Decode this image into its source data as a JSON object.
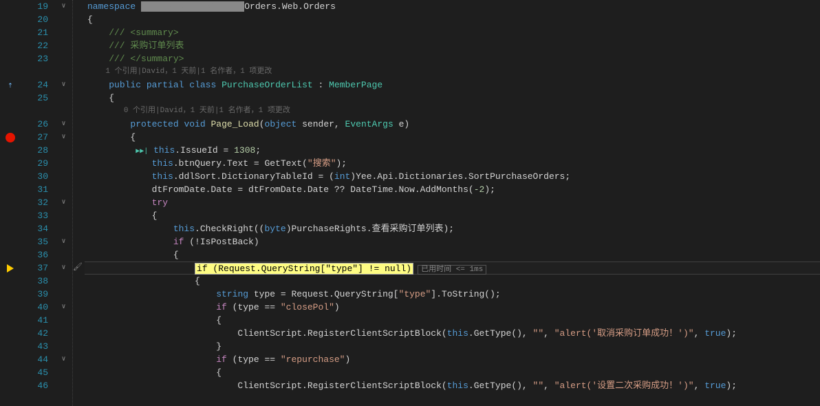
{
  "line_numbers": [
    "19",
    "20",
    "21",
    "22",
    "23",
    "",
    "24",
    "25",
    "",
    "26",
    "27",
    "28",
    "29",
    "30",
    "31",
    "32",
    "33",
    "34",
    "35",
    "36",
    "37",
    "38",
    "39",
    "40",
    "41",
    "42",
    "43",
    "44",
    "45",
    "46"
  ],
  "fold": {
    "l19": "∨",
    "l24": "∨",
    "l26": "∨",
    "l27": "∨",
    "l32": "∨",
    "l35": "∨",
    "l37": "∨",
    "l40": "∨",
    "l44": "∨"
  },
  "codelens": {
    "class": "1 个引用|David，1 天前|1 名作者，1 项更改",
    "method": "0 个引用|David，1 天前|1 名作者，1 项更改"
  },
  "timing": "已用时间 <= 1ms",
  "code": {
    "l19_ns": "namespace",
    "l19_hidden": "XXXXXXXXX",
    "l19_rest": "Orders.Web.Orders",
    "l20": "{",
    "l21": "    /// <summary>",
    "l22": "    /// 采购订单列表",
    "l23": "    /// </summary>",
    "l24_public": "public",
    "l24_partial": "partial",
    "l24_class": "class",
    "l24_name": "PurchaseOrderList",
    "l24_colon": " : ",
    "l24_base": "MemberPage",
    "l25": "    {",
    "l26_prot": "protected",
    "l26_void": "void",
    "l26_method": "Page_Load",
    "l26_obj": "object",
    "l26_sender": " sender, ",
    "l26_evt": "EventArgs",
    "l26_e": " e)",
    "l27": "        {",
    "l28_this": "this",
    "l28_rest": ".IssueId = ",
    "l28_num": "1308",
    "l29_this": "this",
    "l29_a": ".btnQuery.Text = GetText(",
    "l29_s": "\"搜索\"",
    "l29_b": ");",
    "l30_this": "this",
    "l30_a": ".ddlSort.DictionaryTableId = (",
    "l30_int": "int",
    "l30_b": ")Yee.Api.Dictionaries.SortPurchaseOrders;",
    "l31_a": "            dtFromDate.Date = dtFromDate.Date ?? DateTime.Now.AddMonths(",
    "l31_num": "-2",
    "l31_b": ");",
    "l32_try": "try",
    "l33": "            {",
    "l34_this": "this",
    "l34_a": ".CheckRight((",
    "l34_byte": "byte",
    "l34_b": ")PurchaseRights.查看采购订单列表);",
    "l35_if": "if",
    "l35_cond": " (!IsPostBack)",
    "l36": "                {",
    "l37_stmt": "if (Request.QueryString[\"type\"] != null)",
    "l38": "                    {",
    "l39_string": "string",
    "l39_a": " type = Request.QueryString[",
    "l39_s": "\"type\"",
    "l39_b": "].ToString();",
    "l40_if": "if",
    "l40_a": " (type == ",
    "l40_s": "\"closePol\"",
    "l40_b": ")",
    "l41": "                        {",
    "l42_a": "                            ClientScript.RegisterClientScriptBlock(",
    "l42_this": "this",
    "l42_b": ".GetType(), ",
    "l42_s1": "\"\"",
    "l42_c": ", ",
    "l42_s2": "\"alert('取消采购订单成功！')\"",
    "l42_d": ", ",
    "l42_true": "true",
    "l42_e": ");",
    "l43": "                        }",
    "l44_if": "if",
    "l44_a": " (type == ",
    "l44_s": "\"repurchase\"",
    "l44_b": ")",
    "l45": "                        {",
    "l46_a": "                            ClientScript.RegisterClientScriptBlock(",
    "l46_this": "this",
    "l46_b": ".GetType(), ",
    "l46_s1": "\"\"",
    "l46_c": ", ",
    "l46_s2": "\"alert('设置二次采购成功！')\"",
    "l46_d": ", ",
    "l46_true": "true",
    "l46_e": ");"
  }
}
